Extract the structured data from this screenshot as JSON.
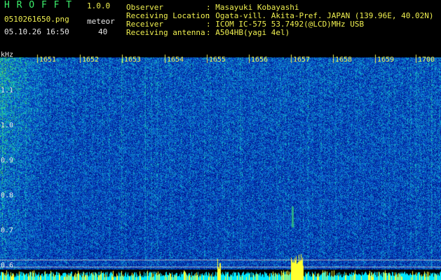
{
  "app": {
    "title_letters": "H R O F F T",
    "version": "1.0.0",
    "filename": "0510261650.png",
    "datetime": "05.10.26 16:50",
    "meteor_label": "meteor",
    "meteor_count": "40"
  },
  "info": {
    "labels": [
      "Observer",
      "Receiving Location",
      "Receiver",
      "Receiving antenna"
    ],
    "values": [
      ": Masayuki Kobayashi",
      ": Ogata-vill. Akita-Pref. JAPAN (139.96E, 40.02N)",
      ": ICOM IC-575 53.7492(@LCD)MHz USB",
      ": A504HB(yagi 4el)"
    ]
  },
  "plot": {
    "freq_unit": "kHz",
    "freq_ticks": [
      "1.1",
      "1.0",
      "0.9",
      "0.8",
      "0.7",
      "0.6"
    ],
    "time_ticks": [
      "1651",
      "1652",
      "1653",
      "1654",
      "1655",
      "1656",
      "1657",
      "1658",
      "1659",
      "1700"
    ]
  },
  "colors": {
    "background": "#000000",
    "header_green": "#3cf06c",
    "header_white": "#e6e6e6",
    "tick_yellow": "#f0f050",
    "activity_bar": "#00e6ff",
    "activity_peak": "#ffff30"
  }
}
